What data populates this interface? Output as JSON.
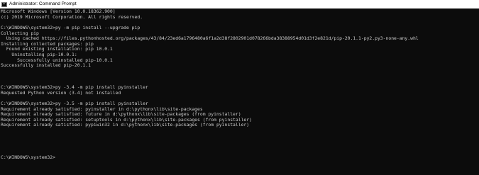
{
  "window": {
    "title": "Administrator: Command Prompt",
    "icon": "cmd-icon",
    "colors": {
      "background": "#0c0c0c",
      "text": "#cccccc",
      "titlebar": "#ffffff"
    }
  },
  "console": {
    "lines": [
      "Microsoft Windows [Version 10.0.18362.900]",
      "(c) 2019 Microsoft Corporation. All rights reserved.",
      "",
      "C:\\WINDOWS\\system32>py -m pip install --upgrade pip",
      "Collecting pip",
      "  Using cached https://files.pythonhosted.org/packages/43/84/23ed6a1796480a6f1a2d38f2802901d078266bda38388954d01d3f2e821d/pip-20.1.1-py2.py3-none-any.whl",
      "Installing collected packages: pip",
      "  Found existing installation: pip 10.0.1",
      "    Uninstalling pip-10.0.1:",
      "      Successfully uninstalled pip-10.0.1",
      "Successfully installed pip-20.1.1",
      "",
      "",
      "",
      "C:\\WINDOWS\\system32>py -3.4 -m pip install pyinstaller",
      "Requested Python version (3.4) not installed",
      "",
      "C:\\WINDOWS\\system32>py -3.5 -m pip install pyinstaller",
      "Requirement already satisfied: pyinstaller in d:\\pythonx\\lib\\site-packages",
      "Requirement already satisfied: future in d:\\pythonx\\lib\\site-packages (from pyinstaller)",
      "Requirement already satisfied: setuptools in d:\\pythonx\\lib\\site-packages (from pyinstaller)",
      "Requirement already satisfied: pypiwin32 in d:\\pythonx\\lib\\site-packages (from pyinstaller)",
      "",
      "",
      "",
      "",
      "",
      "C:\\WINDOWS\\system32>"
    ]
  }
}
